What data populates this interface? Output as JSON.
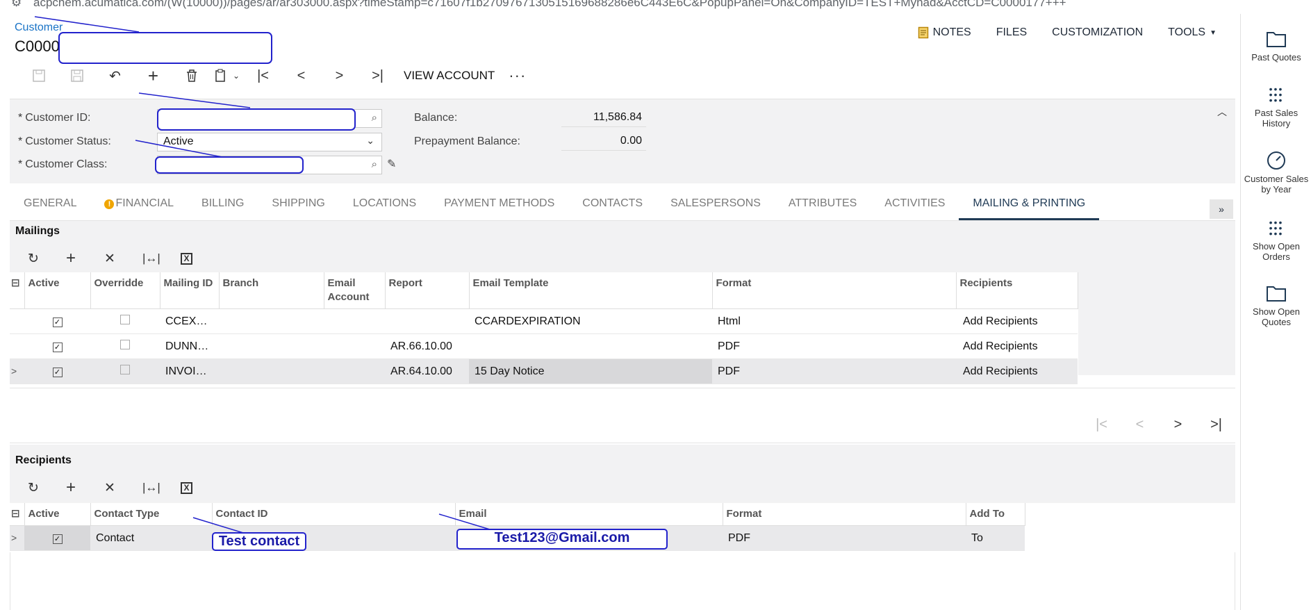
{
  "browser": {
    "url": "acpchem.acumatica.com/(W(10000))/pages/ar/ar303000.aspx?timeStamp=c71607f1b2709767130515169688286e6C443E6C&PopupPanel=On&CompanyID=TEST+Mynad&AcctCD=C0000177+++"
  },
  "header": {
    "breadcrumb": "Customer",
    "title": "C0000",
    "nav": {
      "notes": "NOTES",
      "files": "FILES",
      "customization": "CUSTOMIZATION",
      "tools": "TOOLS"
    }
  },
  "toolbar": {
    "view_account": "VIEW ACCOUNT",
    "more": "···"
  },
  "summary": {
    "customer_id_label": "Customer ID:",
    "customer_id_value": "",
    "customer_status_label": "Customer Status:",
    "customer_status_value": "Active",
    "customer_class_label": "Customer Class:",
    "customer_class_value": "",
    "balance_label": "Balance:",
    "balance_value": "11,586.84",
    "prepayment_label": "Prepayment Balance:",
    "prepayment_value": "0.00"
  },
  "tabs": [
    {
      "label": "GENERAL"
    },
    {
      "label": "FINANCIAL"
    },
    {
      "label": "BILLING"
    },
    {
      "label": "SHIPPING"
    },
    {
      "label": "LOCATIONS"
    },
    {
      "label": "PAYMENT METHODS"
    },
    {
      "label": "CONTACTS"
    },
    {
      "label": "SALESPERSONS"
    },
    {
      "label": "ATTRIBUTES"
    },
    {
      "label": "ACTIVITIES"
    },
    {
      "label": "MAILING & PRINTING"
    }
  ],
  "mailings": {
    "title": "Mailings",
    "columns": [
      "Active",
      "Overridde",
      "Mailing ID",
      "Branch",
      "Email Account",
      "Report",
      "Email Template",
      "Format",
      "Recipients"
    ],
    "rows": [
      {
        "mailing_id": "CCEX…",
        "report": "",
        "template": "CCARDEXPIRATION",
        "format": "Html",
        "recipients": "Add Recipients"
      },
      {
        "mailing_id": "DUNN…",
        "report": "AR.66.10.00",
        "template": "",
        "format": "PDF",
        "recipients": "Add Recipients"
      },
      {
        "mailing_id": "INVOI…",
        "report": "AR.64.10.00",
        "template": "15 Day Notice",
        "format": "PDF",
        "recipients": "Add Recipients"
      }
    ]
  },
  "recipients": {
    "title": "Recipients",
    "columns": [
      "Active",
      "Contact Type",
      "Contact ID",
      "Email",
      "Format",
      "Add To"
    ],
    "rows": [
      {
        "contact_type": "Contact",
        "contact_id": "",
        "email": "",
        "format": "PDF",
        "add_to": "To"
      }
    ]
  },
  "annotations": {
    "contact": "Test contact",
    "email": "Test123@Gmail.com"
  },
  "sidebar": [
    {
      "label": "Past Quotes",
      "icon": "folder-icon"
    },
    {
      "label": "Past Sales History",
      "icon": "dots-grid-icon"
    },
    {
      "label": "Customer Sales by Year",
      "icon": "gauge-icon"
    },
    {
      "label": "Show Open Orders",
      "icon": "dots-grid-icon"
    },
    {
      "label": "Show Open Quotes",
      "icon": "folder-icon"
    }
  ]
}
